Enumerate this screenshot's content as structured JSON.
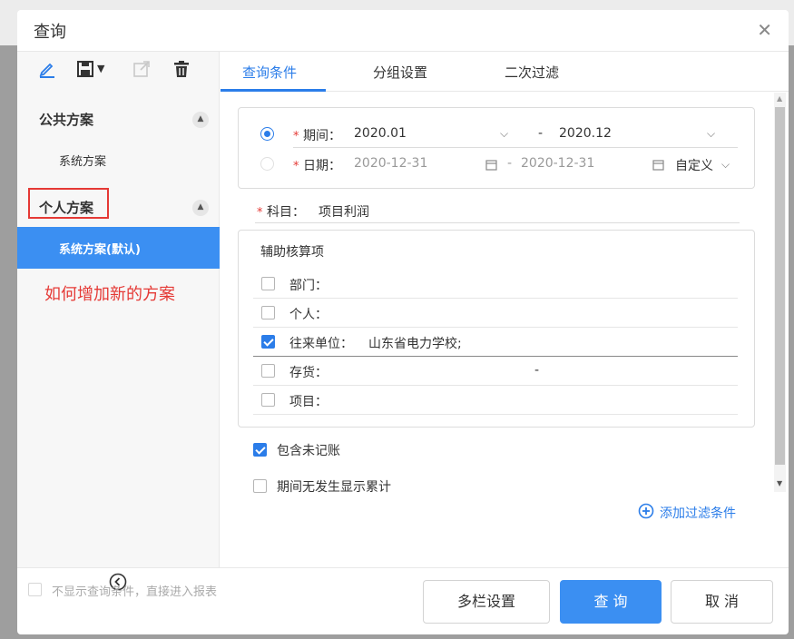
{
  "dialog": {
    "title": "查询",
    "close_icon": "close-icon"
  },
  "toolbar": {
    "icons": [
      "edit-icon",
      "save-icon",
      "export-icon",
      "delete-icon"
    ]
  },
  "schemes": {
    "public_group": "公共方案",
    "public_items": [
      "系统方案"
    ],
    "personal_group": "个人方案",
    "personal_items": [
      "系统方案(默认)"
    ],
    "annotation": "如何增加新的方案"
  },
  "tabs": [
    "查询条件",
    "分组设置",
    "二次过滤"
  ],
  "period": {
    "period_label": "期间：",
    "period_from": "2020.01",
    "dash": "-",
    "period_to": "2020.12",
    "date_label": "日期：",
    "date_from": "2020-12-31",
    "date_to": "2020-12-31",
    "custom": "自定义",
    "required_mark": "*"
  },
  "subject": {
    "label": "科目：",
    "value": "项目利润"
  },
  "auxiliary": {
    "title": "辅助核算项",
    "rows": [
      {
        "label": "部门：",
        "value": "",
        "checked": false
      },
      {
        "label": "个人：",
        "value": "",
        "checked": false
      },
      {
        "label": "往来单位：",
        "value": "山东省电力学校;",
        "checked": true
      },
      {
        "label": "存货：",
        "value": "-",
        "checked": false
      },
      {
        "label": "项目：",
        "value": "",
        "checked": false
      }
    ]
  },
  "options": {
    "include_unposted": "包含未记账",
    "show_cumulative": "期间无发生显示累计"
  },
  "add_filter": "添加过滤条件",
  "footer": {
    "skip_conditions": "不显示查询条件，直接进入报表",
    "multi_column": "多栏设置",
    "query": "查 询",
    "cancel": "取 消"
  },
  "colors": {
    "accent": "#3b8ff2",
    "required": "#e53935"
  }
}
